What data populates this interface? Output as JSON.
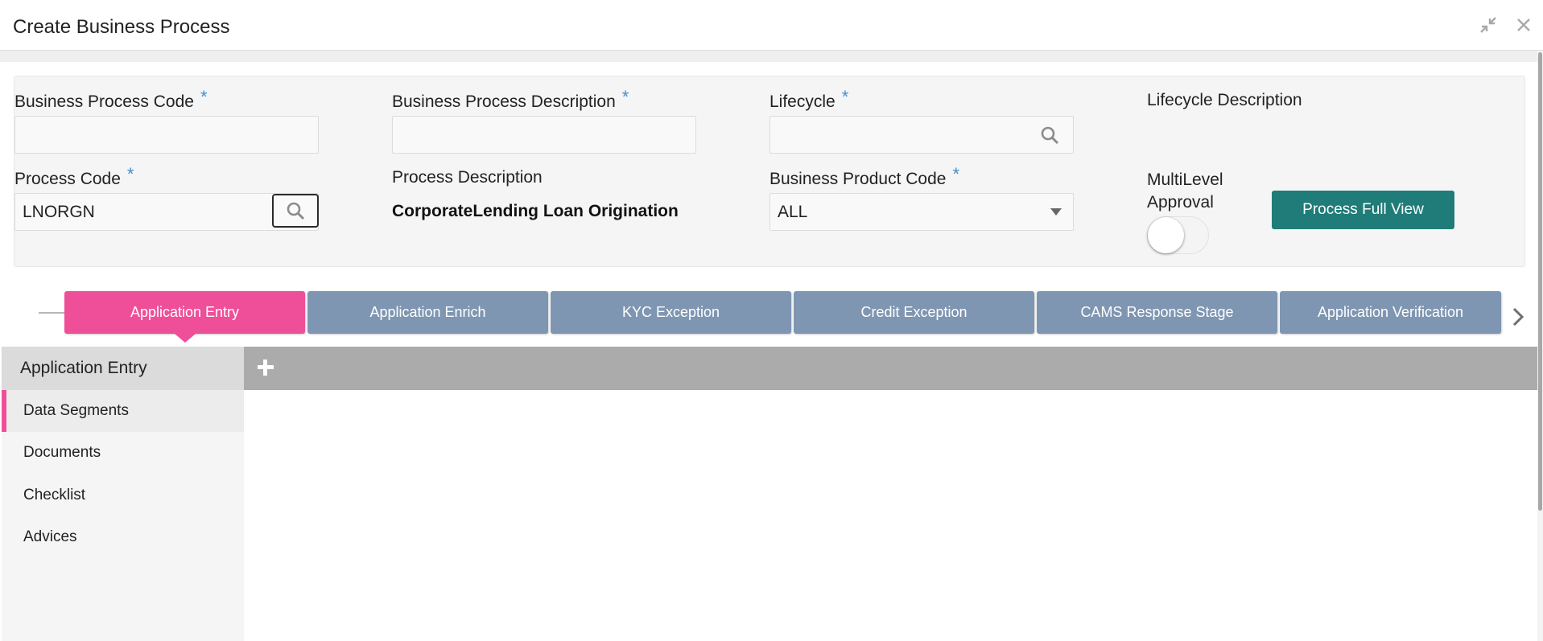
{
  "header": {
    "title": "Create Business Process",
    "icons": [
      "minimize-icon",
      "close-icon"
    ]
  },
  "form": {
    "bp_code": {
      "label": "Business Process Code",
      "required_mark": "*",
      "value": ""
    },
    "bp_description": {
      "label": "Business Process Description",
      "required_mark": "*",
      "value": ""
    },
    "lifecycle": {
      "label": "Lifecycle",
      "required_mark": "*",
      "value": "",
      "icon": "search-icon"
    },
    "lifecycle_description": {
      "label": "Lifecycle Description"
    },
    "process_code": {
      "label": "Process Code",
      "required_mark": "*",
      "value": "LNORGN",
      "icon": "search-icon"
    },
    "process_description": {
      "label": "Process Description",
      "value": "CorporateLending Loan Origination"
    },
    "business_product_code": {
      "label": "Business Product Code",
      "required_mark": "*",
      "value": "ALL",
      "icon": "caret-down-icon"
    },
    "multilevel_approval": {
      "label_line1": "MultiLevel",
      "label_line2": "Approval",
      "enabled": false
    },
    "process_full_view_label": "Process Full View"
  },
  "stages": [
    {
      "label": "Application Entry",
      "active": true
    },
    {
      "label": "Application Enrich",
      "active": false
    },
    {
      "label": "KYC Exception",
      "active": false
    },
    {
      "label": "Credit Exception",
      "active": false
    },
    {
      "label": "CAMS Response Stage",
      "active": false
    },
    {
      "label": "Application Verification",
      "active": false
    }
  ],
  "stage_panel": {
    "title": "Application Entry",
    "items": [
      {
        "label": "Data Segments",
        "active": true
      },
      {
        "label": "Documents",
        "active": false
      },
      {
        "label": "Checklist",
        "active": false
      },
      {
        "label": "Advices",
        "active": false
      }
    ],
    "add_icon": "plus-icon"
  },
  "colors": {
    "accent_pink": "#ef4f98",
    "stage_blue": "#7f96b2",
    "primary_teal": "#1f7c78",
    "required_blue": "#3d8fd6"
  }
}
